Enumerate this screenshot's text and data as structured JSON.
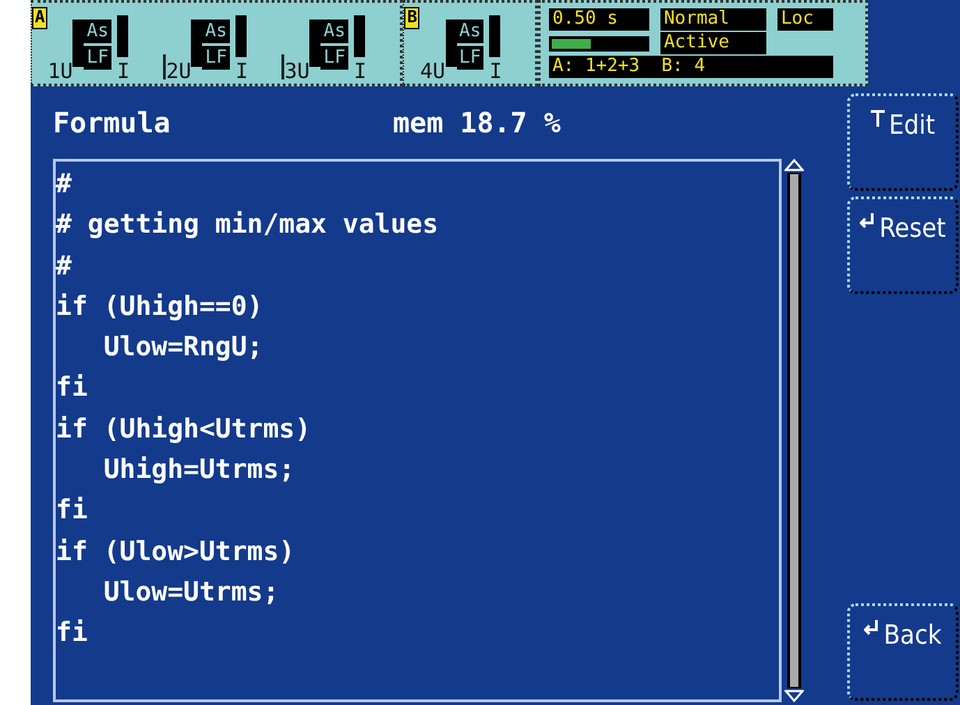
{
  "groups": [
    {
      "label": "A",
      "channels": [
        {
          "voltage": "1U",
          "flags": [
            "As",
            "LF"
          ],
          "current": "I"
        },
        {
          "voltage": "2U",
          "flags": [
            "As",
            "LF"
          ],
          "current": "I"
        },
        {
          "voltage": "3U",
          "flags": [
            "As",
            "LF"
          ],
          "current": "I"
        }
      ]
    },
    {
      "label": "B",
      "channels": [
        {
          "voltage": "4U",
          "flags": [
            "As",
            "LF"
          ],
          "current": "I"
        }
      ]
    }
  ],
  "status": {
    "interval": "0.50 s",
    "mode": "Normal",
    "control": "Loc",
    "level": 0.4,
    "state": "Active",
    "wiring": "A: 1+2+3  B: 4"
  },
  "header": {
    "title": "Formula",
    "memory": "mem 18.7 %"
  },
  "code_lines": [
    "#",
    "# getting min/max values",
    "#",
    "if (Uhigh==0)",
    "   Ulow=RngU;",
    "fi",
    "if (Uhigh<Utrms)",
    "   Uhigh=Utrms;",
    "fi",
    "if (Ulow>Utrms)",
    "   Ulow=Utrms;",
    "fi"
  ],
  "softkeys": [
    {
      "label": "Edit",
      "kind": "text"
    },
    {
      "label": "Reset",
      "kind": "enter"
    },
    {
      "label": "Back",
      "kind": "enter"
    }
  ]
}
